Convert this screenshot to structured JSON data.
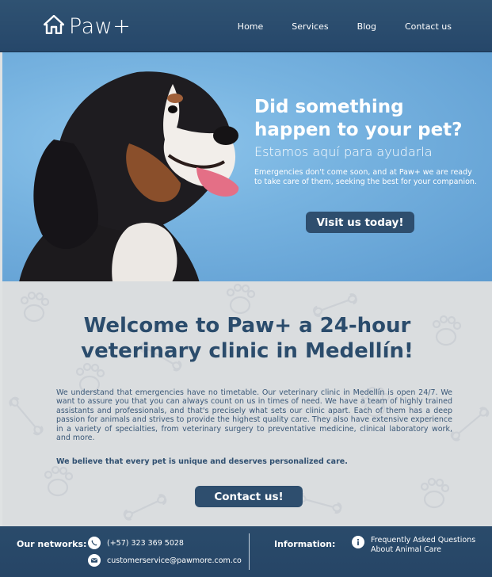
{
  "header": {
    "logo_text": "Paw+",
    "nav": [
      "Home",
      "Services",
      "Blog",
      "Contact us"
    ]
  },
  "hero": {
    "title": "Did something  happen to your pet?",
    "subtitle": "Estamos aquí para ayudarla",
    "description": "Emergencies don't come soon, and at Paw+ we are ready to take care of them, seeking the best for your companion.",
    "button": "Visit us today!"
  },
  "welcome": {
    "title_line1": "Welcome to Paw+ a 24-hour",
    "title_line2": "veterinary clinic in Medellín!",
    "paragraph": "We understand that emergencies have no timetable. Our veterinary clinic in Medellín is open 24/7. We want to assure you that you can always count on us in times of need. We have a team of highly trained assistants and professionals, and that's precisely what sets our clinic apart. Each of them has a deep passion for animals and strives to provide the highest  quality care. They also have extensive experience in a variety of specialties, from veterinary surgery to preventative medicine, clinical laboratory work, and more.",
    "highlight": "We believe that every pet is unique and deserves personalized care.",
    "button": "Contact  us!"
  },
  "footer": {
    "networks_label": "Our networks:",
    "phone": "(+57) 323 369 5028",
    "email": "customerservice@pawmore.com.co",
    "information_label": "Information:",
    "faq_line1": "Frequently Asked Questions",
    "faq_line2": "About Animal Care"
  },
  "colors": {
    "header_bg": "#2f5272",
    "button_bg": "#2e4e6e",
    "title_color": "#2b4c6c",
    "hero_bg": "#77b3e0"
  },
  "icons": [
    "house-icon",
    "whatsapp-icon",
    "email-icon",
    "info-icon",
    "paw-pattern"
  ]
}
